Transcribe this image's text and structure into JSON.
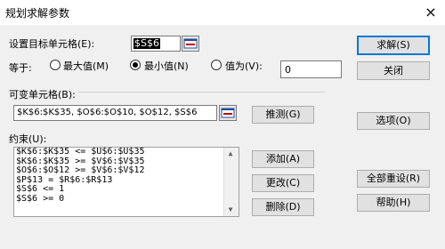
{
  "window": {
    "title": "规划求解参数",
    "close_glyph": "×"
  },
  "target": {
    "label": "设置目标单元格(E):",
    "value": "$S$6"
  },
  "equal": {
    "label": "等于:",
    "options": [
      {
        "label": "最大值(M)",
        "selected": false
      },
      {
        "label": "最小值(N)",
        "selected": true
      },
      {
        "label": "值为(V):",
        "selected": false
      }
    ],
    "value": "0"
  },
  "variable": {
    "label": "可变单元格(B):",
    "value": "$K$6:$K$35, $O$6:$O$10, $O$12, $S$6",
    "guess_button": "推测(G)"
  },
  "constraints": {
    "label": "约束(U):",
    "items": [
      "$K$6:$K$35 <= $U$6:$U$35",
      "$K$6:$K$35 >= $V$6:$V$35",
      "$O$6:$O$12 >= $V$6:$V$12",
      "$P$13 = $R$6:$R$13",
      "$S$6 <= 1",
      "$S$6 >= 0"
    ],
    "add_button": "添加(A)",
    "change_button": "更改(C)",
    "delete_button": "删除(D)"
  },
  "right_buttons": {
    "solve": "求解(S)",
    "close": "关闭",
    "options": "选项(O)",
    "reset_all": "全部重设(R)",
    "help": "帮助(H)"
  },
  "colors": {
    "accent": "#0078d7",
    "background": "#f0f0f0"
  },
  "icons": {
    "ref_button": "collapse-dialog-icon",
    "scroll_up": "arrow-up-icon",
    "scroll_down": "arrow-down-icon"
  }
}
